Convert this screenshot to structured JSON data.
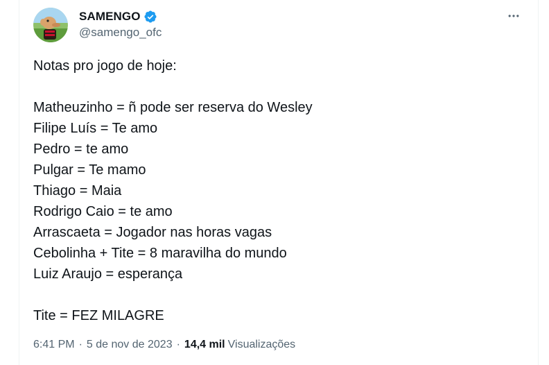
{
  "author": {
    "display_name": "SAMENGO",
    "handle": "@samengo_ofc",
    "verified_color": "#1d9bf0",
    "avatar_bg": "#6fa84a"
  },
  "tweet": {
    "lines": [
      "Notas pro jogo de hoje:",
      "",
      "Matheuzinho = ñ pode ser reserva do Wesley",
      "Filipe Luís = Te amo",
      "Pedro = te amo",
      "Pulgar = Te mamo",
      "Thiago = Maia",
      "Rodrigo Caio = te amo",
      "Arrascaeta = Jogador nas horas vagas",
      "Cebolinha + Tite = 8 maravilha do mundo",
      "Luiz Araujo = esperança",
      "",
      "Tite = FEZ MILAGRE"
    ]
  },
  "meta": {
    "time": "6:41 PM",
    "date": "5 de nov de 2023",
    "views_count": "14,4 mil",
    "views_label": "Visualizações",
    "separator": "·"
  },
  "icons": {
    "more": "more-horizontal-icon",
    "verified": "verified-badge-icon"
  }
}
